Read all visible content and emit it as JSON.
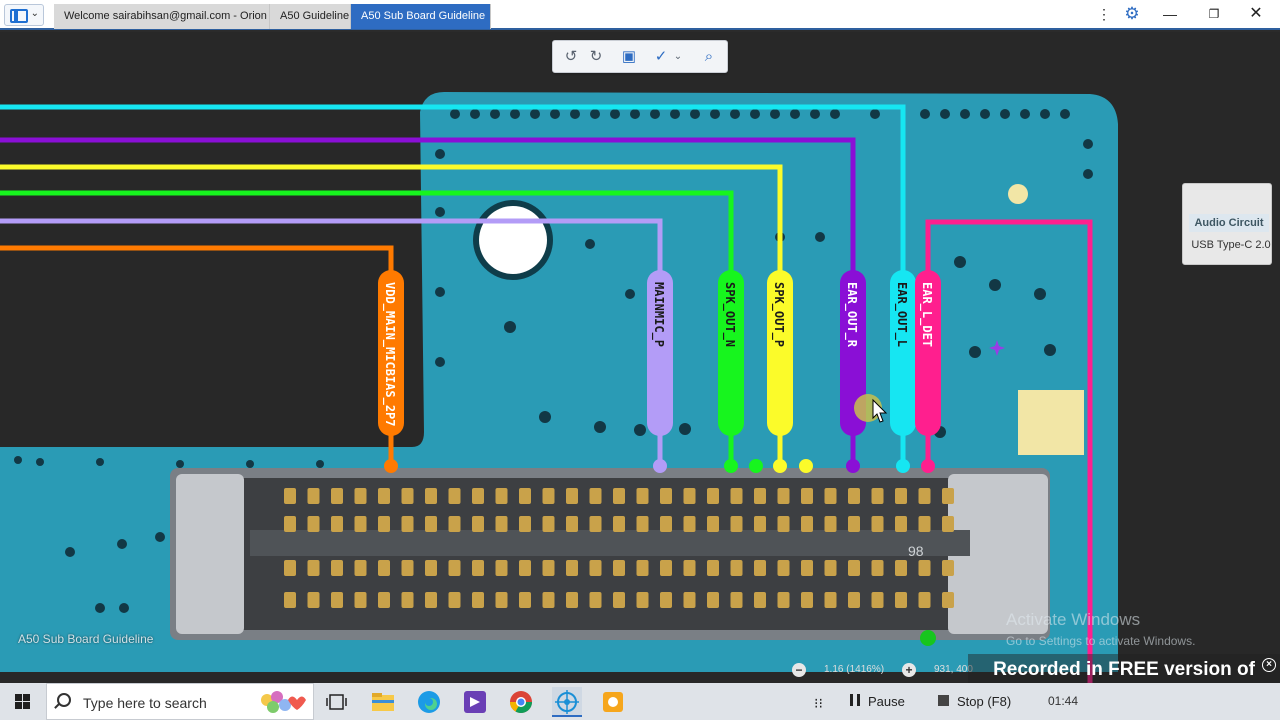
{
  "titlebar": {
    "tabs": [
      {
        "label": "Welcome sairabihsan@gmail.com - Orion"
      },
      {
        "label": "A50 Guideline"
      },
      {
        "label": "A50 Sub Board Guideline"
      }
    ],
    "kebab": "⋮",
    "gear": "⚙",
    "minimize": "—",
    "maximize": "❐",
    "close": "✕"
  },
  "toolbar": {
    "rotate_left": "↺",
    "rotate_right": "↻",
    "fit": "▣",
    "check": "✓",
    "caret": "⌄",
    "search": "⌕"
  },
  "side_panel": {
    "items": [
      "Audio Circuit",
      "USB Type-C 2.0"
    ]
  },
  "pins": [
    {
      "label": "VDD_MAIN_MICBIAS_2P7",
      "color": "#ff7a00"
    },
    {
      "label": "MAINMIC_P",
      "color": "#b39cf7"
    },
    {
      "label": "SPK_OUT_N",
      "color": "#17f51e"
    },
    {
      "label": "SPK_OUT_P",
      "color": "#fbfb2a"
    },
    {
      "label": "EAR_OUT_R",
      "color": "#8a0fd6"
    },
    {
      "label": "EAR_OUT_L",
      "color": "#16e6f2"
    },
    {
      "label": "EAR_L_DET",
      "color": "#ff1f8e"
    }
  ],
  "board_title": "A50 Sub Board Guideline",
  "connector_number": "98",
  "os_watermark": {
    "line1": "Activate Windows",
    "line2": "Go to Settings to activate Windows."
  },
  "zoom": {
    "minus": "−",
    "level": "1.16 (1416%)",
    "plus": "+",
    "coords": "931, 400"
  },
  "recorder": {
    "banner": "Recorded in FREE version of Icecream Screen Recorder",
    "close": "×",
    "pause_label": "Pause",
    "stop_label": "Stop (F8)",
    "time": "01:44"
  },
  "taskbar": {
    "search_placeholder": "Type here to search",
    "grip": "⁝⁝"
  },
  "colors": {
    "pcb": "#2a9bb5",
    "titlebar_accent": "#2e6cc2"
  }
}
